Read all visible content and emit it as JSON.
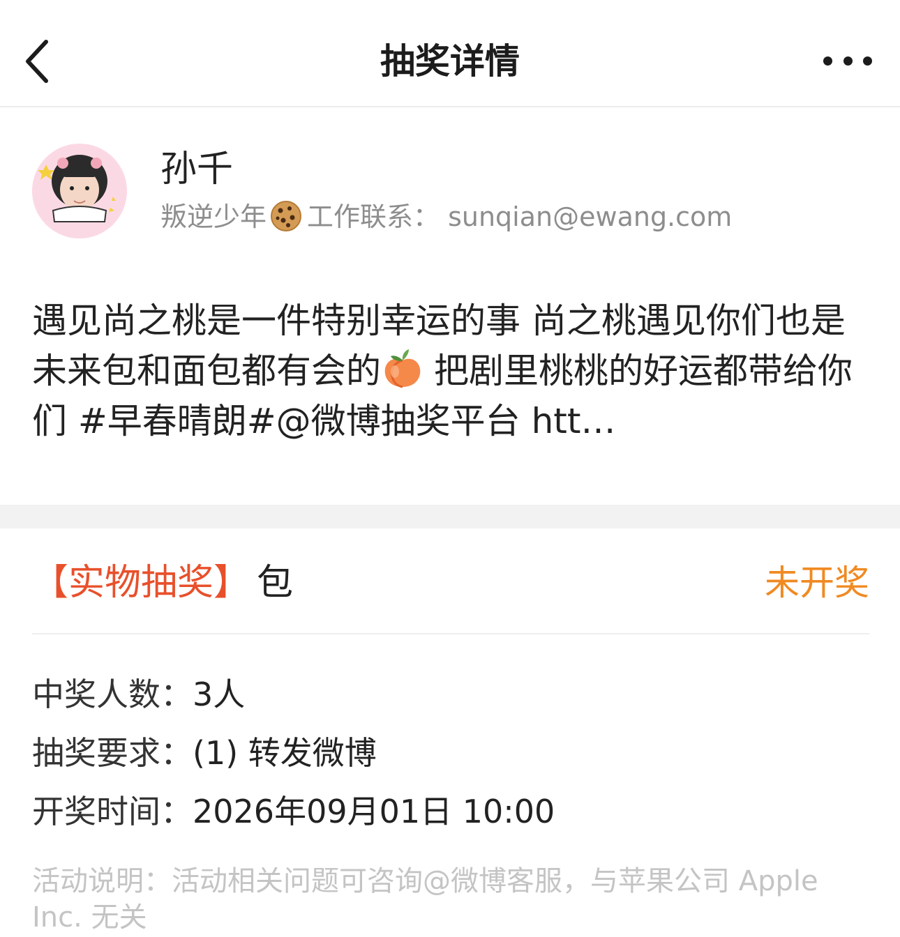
{
  "nav": {
    "title": "抽奖详情",
    "back_icon": "chevron-left-icon",
    "more_icon": "more-dots-icon"
  },
  "user": {
    "name": "孙千",
    "bio_prefix": "叛逆少年",
    "bio_suffix": "工作联系： sunqian@ewang.com",
    "avatar_icon": "avatar-photo",
    "bio_emoji": "cookie-icon"
  },
  "post": {
    "text_part1": "遇见尚之桃是一件特别幸运的事 尚之桃遇见你们也是 未来包和面包都有会的",
    "text_part2": "把剧里桃桃的好运都带给你们 #早春晴朗#@微博抽奖平台 ",
    "link": "htt…",
    "emoji": "peach-icon"
  },
  "prize": {
    "tag": "【实物抽奖】",
    "name": "包",
    "status": "未开奖"
  },
  "details": {
    "winners_label": "中奖人数：",
    "winners_value": "3人",
    "requirement_label": "抽奖要求：",
    "requirement_value": "(1) 转发微博",
    "draw_time_label": "开奖时间：",
    "draw_time_value": "2026年09月01日 10:00"
  },
  "footnote": "活动说明：活动相关问题可咨询@微博客服，与苹果公司 Apple Inc. 无关",
  "colors": {
    "tag": "#e8502b",
    "status": "#f08a22",
    "muted": "#8d8d8d",
    "footnote": "#c4c4c4"
  }
}
